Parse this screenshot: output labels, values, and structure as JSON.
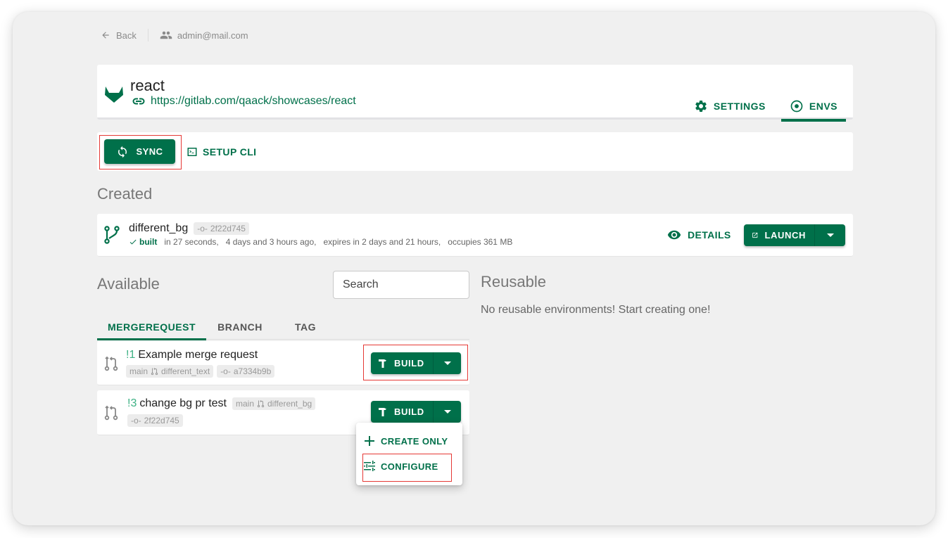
{
  "topbar": {
    "back_label": "Back",
    "user_email": "admin@mail.com"
  },
  "project": {
    "name": "react",
    "url": "https://gitlab.com/qaack/showcases/react",
    "tabs": [
      {
        "label": "SETTINGS",
        "icon": "gear-icon",
        "active": false
      },
      {
        "label": "ENVS",
        "icon": "radio-target-icon",
        "active": true
      }
    ]
  },
  "toolbar": {
    "sync_label": "SYNC",
    "setup_cli_label": "SETUP CLI"
  },
  "created": {
    "title": "Created",
    "env": {
      "name": "different_bg",
      "commit": "2f22d745",
      "status": "built",
      "build_time": "in 27 seconds,",
      "age": "4 days and 3 hours ago,",
      "expires": "expires in 2 days and 21 hours,",
      "size": "occupies 361 MB",
      "details_label": "DETAILS",
      "launch_label": "LAUNCH"
    }
  },
  "available": {
    "title": "Available",
    "search_placeholder": "Search",
    "tabs": [
      {
        "label": "MERGEREQUEST",
        "active": true
      },
      {
        "label": "BRANCH",
        "active": false
      },
      {
        "label": "TAG",
        "active": false
      }
    ],
    "merge_requests": [
      {
        "number": "!1",
        "title": "Example merge request",
        "target": "main",
        "source": "different_text",
        "commit": "a7334b9b",
        "build_label": "BUILD"
      },
      {
        "number": "!3",
        "title": "change bg pr test",
        "target": "main",
        "source": "different_bg",
        "commit": "2f22d745",
        "build_label": "BUILD"
      }
    ],
    "build_menu": {
      "items": [
        {
          "label": "CREATE ONLY",
          "icon": "plus-icon"
        },
        {
          "label": "CONFIGURE",
          "icon": "sliders-icon"
        }
      ]
    }
  },
  "reusable": {
    "title": "Reusable",
    "empty_message": "No reusable environments! Start creating one!"
  },
  "colors": {
    "accent": "#00704a",
    "mr_number": "#3db184",
    "highlight": "#e53935",
    "background": "#f0f0f0"
  }
}
